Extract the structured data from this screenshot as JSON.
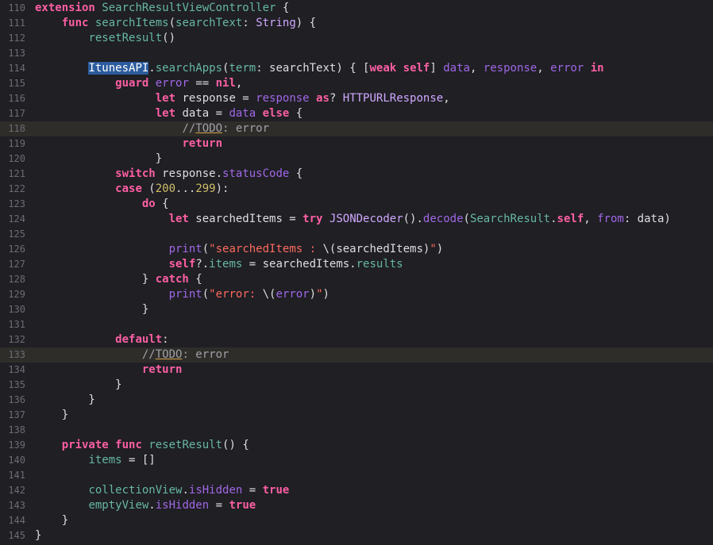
{
  "colors": {
    "background": "#1f1f24",
    "highlight_line": "#2f2d29",
    "keyword": "#fc5fa3",
    "project_function": "#67b7a4",
    "type": "#d0a8ff",
    "other_property": "#a167e6",
    "string": "#fc6a5d",
    "number": "#d0bf69",
    "comment": "#a0a0a8",
    "plain": "#dfdfe0",
    "selection": "#2c5c9e"
  },
  "editor": {
    "lines": [
      {
        "num": "110",
        "tokens": [
          {
            "t": "extension",
            "c": "kw"
          },
          {
            "t": " "
          },
          {
            "t": "SearchResultViewController",
            "c": "fn"
          },
          {
            "t": " {"
          }
        ]
      },
      {
        "num": "111",
        "tokens": [
          {
            "t": "    "
          },
          {
            "t": "func",
            "c": "kw"
          },
          {
            "t": " "
          },
          {
            "t": "searchItems",
            "c": "fn"
          },
          {
            "t": "("
          },
          {
            "t": "searchText",
            "c": "fn"
          },
          {
            "t": ": "
          },
          {
            "t": "String",
            "c": "ty"
          },
          {
            "t": ") {"
          }
        ]
      },
      {
        "num": "112",
        "tokens": [
          {
            "t": "        "
          },
          {
            "t": "resetResult",
            "c": "fn"
          },
          {
            "t": "()"
          }
        ]
      },
      {
        "num": "113",
        "tokens": []
      },
      {
        "num": "114",
        "tokens": [
          {
            "t": "        "
          },
          {
            "t": "ItunesAPI",
            "c": "sel"
          },
          {
            "t": "."
          },
          {
            "t": "searchApps",
            "c": "fn"
          },
          {
            "t": "("
          },
          {
            "t": "term",
            "c": "fn"
          },
          {
            "t": ": searchText) { ["
          },
          {
            "t": "weak",
            "c": "kw"
          },
          {
            "t": " "
          },
          {
            "t": "self",
            "c": "kw"
          },
          {
            "t": "] "
          },
          {
            "t": "data",
            "c": "pl"
          },
          {
            "t": ", "
          },
          {
            "t": "response",
            "c": "pl"
          },
          {
            "t": ", "
          },
          {
            "t": "error",
            "c": "pl"
          },
          {
            "t": " "
          },
          {
            "t": "in",
            "c": "kw"
          }
        ]
      },
      {
        "num": "115",
        "tokens": [
          {
            "t": "            "
          },
          {
            "t": "guard",
            "c": "kw"
          },
          {
            "t": " "
          },
          {
            "t": "error",
            "c": "pl"
          },
          {
            "t": " == "
          },
          {
            "t": "nil",
            "c": "kw"
          },
          {
            "t": ","
          }
        ]
      },
      {
        "num": "116",
        "tokens": [
          {
            "t": "                  "
          },
          {
            "t": "let",
            "c": "kw"
          },
          {
            "t": " response = "
          },
          {
            "t": "response",
            "c": "pl"
          },
          {
            "t": " "
          },
          {
            "t": "as",
            "c": "kw"
          },
          {
            "t": "? "
          },
          {
            "t": "HTTPURLResponse",
            "c": "ty"
          },
          {
            "t": ","
          }
        ]
      },
      {
        "num": "117",
        "tokens": [
          {
            "t": "                  "
          },
          {
            "t": "let",
            "c": "kw"
          },
          {
            "t": " data = "
          },
          {
            "t": "data",
            "c": "pl"
          },
          {
            "t": " "
          },
          {
            "t": "else",
            "c": "kw"
          },
          {
            "t": " {"
          }
        ]
      },
      {
        "num": "118",
        "hl": true,
        "tokens": [
          {
            "t": "                      "
          },
          {
            "t": "//",
            "c": "cm"
          },
          {
            "t": "TODO",
            "c": "tk"
          },
          {
            "t": ": error",
            "c": "cm"
          }
        ]
      },
      {
        "num": "119",
        "tokens": [
          {
            "t": "                      "
          },
          {
            "t": "return",
            "c": "kw"
          }
        ]
      },
      {
        "num": "120",
        "tokens": [
          {
            "t": "                  }"
          }
        ]
      },
      {
        "num": "121",
        "tokens": [
          {
            "t": "            "
          },
          {
            "t": "switch",
            "c": "kw"
          },
          {
            "t": " response."
          },
          {
            "t": "statusCode",
            "c": "pl"
          },
          {
            "t": " {"
          }
        ]
      },
      {
        "num": "122",
        "tokens": [
          {
            "t": "            "
          },
          {
            "t": "case",
            "c": "kw"
          },
          {
            "t": " ("
          },
          {
            "t": "200",
            "c": "nm"
          },
          {
            "t": "..."
          },
          {
            "t": "299",
            "c": "nm"
          },
          {
            "t": "):"
          }
        ]
      },
      {
        "num": "123",
        "tokens": [
          {
            "t": "                "
          },
          {
            "t": "do",
            "c": "kw"
          },
          {
            "t": " {"
          }
        ]
      },
      {
        "num": "124",
        "tokens": [
          {
            "t": "                    "
          },
          {
            "t": "let",
            "c": "kw"
          },
          {
            "t": " searchedItems = "
          },
          {
            "t": "try",
            "c": "kw"
          },
          {
            "t": " "
          },
          {
            "t": "JSONDecoder",
            "c": "ty"
          },
          {
            "t": "()."
          },
          {
            "t": "decode",
            "c": "pl"
          },
          {
            "t": "("
          },
          {
            "t": "SearchResult",
            "c": "fn"
          },
          {
            "t": "."
          },
          {
            "t": "self",
            "c": "kw"
          },
          {
            "t": ", "
          },
          {
            "t": "from",
            "c": "pl"
          },
          {
            "t": ": data)"
          }
        ]
      },
      {
        "num": "125",
        "tokens": []
      },
      {
        "num": "126",
        "tokens": [
          {
            "t": "                    "
          },
          {
            "t": "print",
            "c": "pl"
          },
          {
            "t": "("
          },
          {
            "t": "\"searchedItems : ",
            "c": "st"
          },
          {
            "t": "\\(searchedItems)"
          },
          {
            "t": "\"",
            "c": "st"
          },
          {
            "t": ")"
          }
        ]
      },
      {
        "num": "127",
        "tokens": [
          {
            "t": "                    "
          },
          {
            "t": "self",
            "c": "kw"
          },
          {
            "t": "?."
          },
          {
            "t": "items",
            "c": "fn"
          },
          {
            "t": " = searchedItems."
          },
          {
            "t": "results",
            "c": "fn"
          }
        ]
      },
      {
        "num": "128",
        "tokens": [
          {
            "t": "                } "
          },
          {
            "t": "catch",
            "c": "kw"
          },
          {
            "t": " {"
          }
        ]
      },
      {
        "num": "129",
        "tokens": [
          {
            "t": "                    "
          },
          {
            "t": "print",
            "c": "pl"
          },
          {
            "t": "("
          },
          {
            "t": "\"error: ",
            "c": "st"
          },
          {
            "t": "\\("
          },
          {
            "t": "error",
            "c": "pl"
          },
          {
            "t": ")"
          },
          {
            "t": "\"",
            "c": "st"
          },
          {
            "t": ")"
          }
        ]
      },
      {
        "num": "130",
        "tokens": [
          {
            "t": "                }"
          }
        ]
      },
      {
        "num": "131",
        "tokens": []
      },
      {
        "num": "132",
        "tokens": [
          {
            "t": "            "
          },
          {
            "t": "default",
            "c": "kw"
          },
          {
            "t": ":"
          }
        ]
      },
      {
        "num": "133",
        "hl": true,
        "tokens": [
          {
            "t": "                "
          },
          {
            "t": "//",
            "c": "cm"
          },
          {
            "t": "TODO",
            "c": "tk"
          },
          {
            "t": ": error",
            "c": "cm"
          }
        ]
      },
      {
        "num": "134",
        "tokens": [
          {
            "t": "                "
          },
          {
            "t": "return",
            "c": "kw"
          }
        ]
      },
      {
        "num": "135",
        "tokens": [
          {
            "t": "            }"
          }
        ]
      },
      {
        "num": "136",
        "tokens": [
          {
            "t": "        }"
          }
        ]
      },
      {
        "num": "137",
        "tokens": [
          {
            "t": "    }"
          }
        ]
      },
      {
        "num": "138",
        "tokens": []
      },
      {
        "num": "139",
        "tokens": [
          {
            "t": "    "
          },
          {
            "t": "private",
            "c": "kw"
          },
          {
            "t": " "
          },
          {
            "t": "func",
            "c": "kw"
          },
          {
            "t": " "
          },
          {
            "t": "resetResult",
            "c": "fn"
          },
          {
            "t": "() {"
          }
        ]
      },
      {
        "num": "140",
        "tokens": [
          {
            "t": "        "
          },
          {
            "t": "items",
            "c": "fn"
          },
          {
            "t": " = []"
          }
        ]
      },
      {
        "num": "141",
        "tokens": []
      },
      {
        "num": "142",
        "tokens": [
          {
            "t": "        "
          },
          {
            "t": "collectionView",
            "c": "fn"
          },
          {
            "t": "."
          },
          {
            "t": "isHidden",
            "c": "pl"
          },
          {
            "t": " = "
          },
          {
            "t": "true",
            "c": "kw"
          }
        ]
      },
      {
        "num": "143",
        "tokens": [
          {
            "t": "        "
          },
          {
            "t": "emptyView",
            "c": "fn"
          },
          {
            "t": "."
          },
          {
            "t": "isHidden",
            "c": "pl"
          },
          {
            "t": " = "
          },
          {
            "t": "true",
            "c": "kw"
          }
        ]
      },
      {
        "num": "144",
        "tokens": [
          {
            "t": "    }"
          }
        ]
      },
      {
        "num": "145",
        "tokens": [
          {
            "t": "}"
          }
        ]
      }
    ]
  }
}
